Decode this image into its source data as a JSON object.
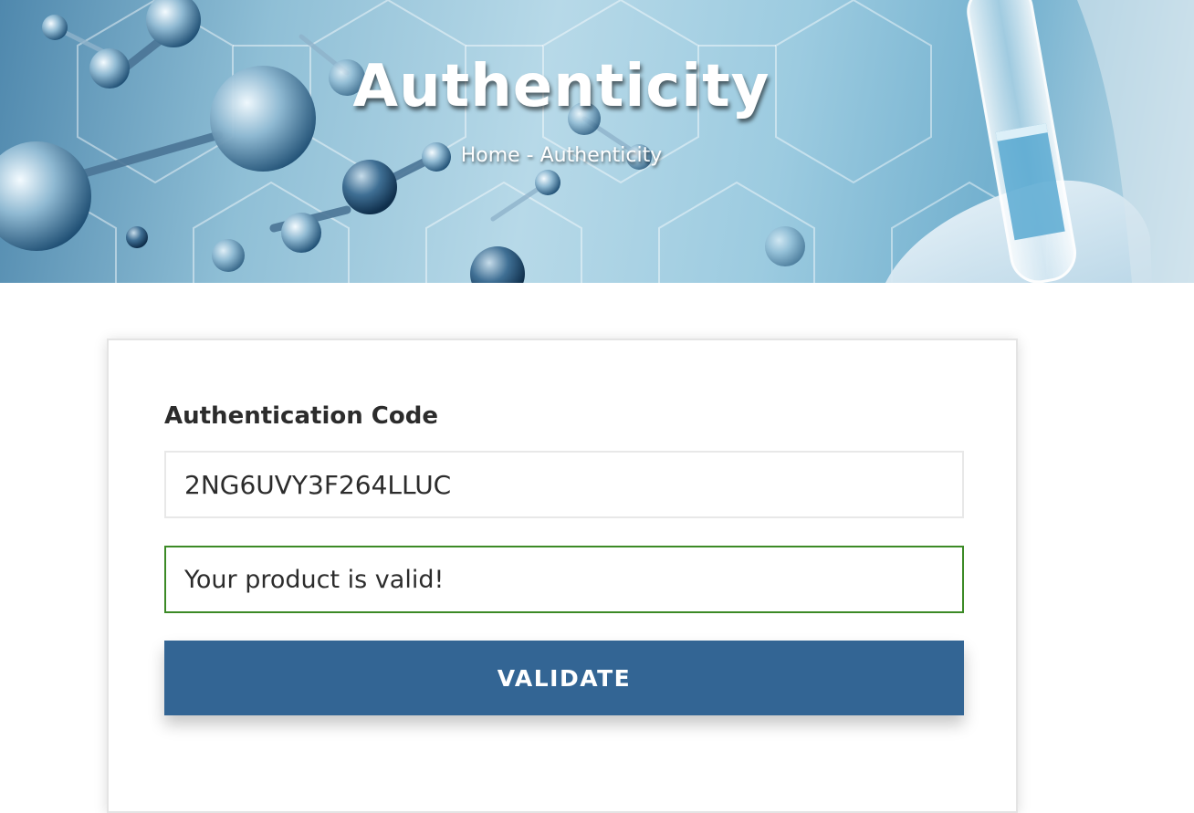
{
  "hero": {
    "title": "Authenticity",
    "breadcrumb": {
      "home": "Home",
      "separator": " - ",
      "current": "Authenticity"
    }
  },
  "form": {
    "label": "Authentication Code",
    "code_value": "2NG6UVY3F264LLUC",
    "result_message": "Your product is valid!",
    "submit_label": "VALIDATE"
  },
  "colors": {
    "button": "#336594",
    "valid_border": "#3c8a26",
    "label_text": "#2c2c2c"
  },
  "icons": {
    "hero_decoration": "molecule-and-test-tube-image"
  }
}
